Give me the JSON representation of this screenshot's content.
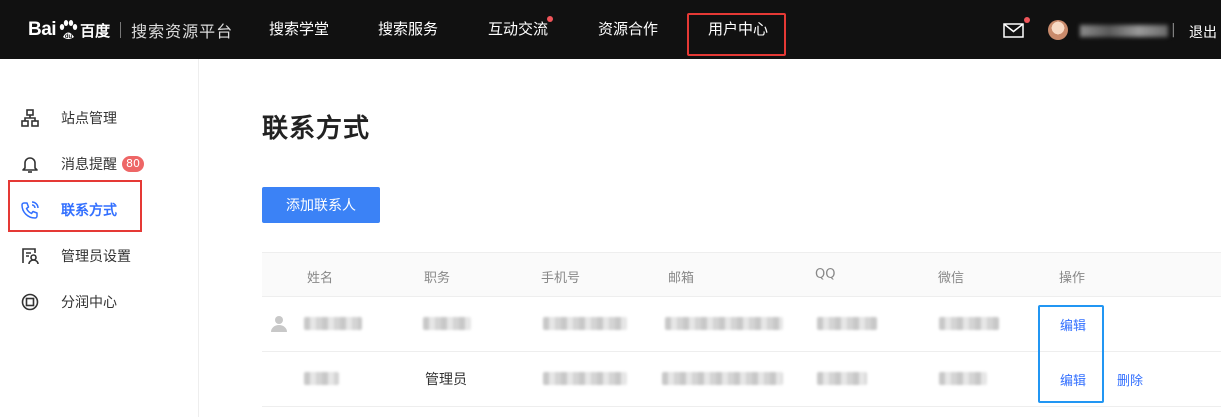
{
  "header": {
    "logo_bai": "Bai",
    "logo_du": "百度",
    "logo_title": "搜索资源平台",
    "nav": [
      {
        "label": "搜索学堂",
        "dot": false
      },
      {
        "label": "搜索服务",
        "dot": false
      },
      {
        "label": "互动交流",
        "dot": true
      },
      {
        "label": "资源合作",
        "dot": false
      },
      {
        "label": "用户中心",
        "dot": false
      }
    ],
    "separator": "|",
    "logout": "退出"
  },
  "sidebar": {
    "items": [
      {
        "label": "站点管理",
        "icon": "sitemap-icon",
        "active": false
      },
      {
        "label": "消息提醒",
        "icon": "bell-icon",
        "active": false,
        "badge": "80"
      },
      {
        "label": "联系方式",
        "icon": "phone-icon",
        "active": true
      },
      {
        "label": "管理员设置",
        "icon": "admin-icon",
        "active": false
      },
      {
        "label": "分润中心",
        "icon": "share-icon",
        "active": false
      }
    ]
  },
  "main": {
    "title": "联系方式",
    "add_button": "添加联系人",
    "table": {
      "columns": [
        "姓名",
        "职务",
        "手机号",
        "邮箱",
        "QQ",
        "微信",
        "操作"
      ],
      "rows": [
        {
          "role": "",
          "actions": [
            "编辑"
          ]
        },
        {
          "role": "管理员",
          "actions": [
            "编辑",
            "删除"
          ]
        }
      ]
    }
  },
  "colors": {
    "accent": "#3370ff",
    "topbar": "#111111",
    "button": "#3b82f6",
    "highlight_red": "#e53935",
    "highlight_blue": "#2196f3"
  }
}
